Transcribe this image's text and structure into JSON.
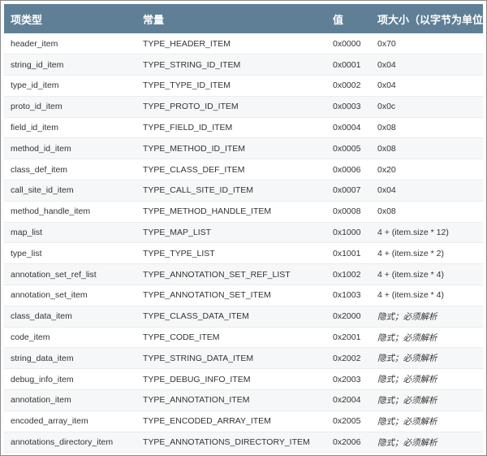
{
  "table": {
    "headers": [
      "项类型",
      "常量",
      "值",
      "项大小（以字节为单位)"
    ],
    "rows": [
      {
        "item": "header_item",
        "constant": "TYPE_HEADER_ITEM",
        "value": "0x0000",
        "size": "0x70"
      },
      {
        "item": "string_id_item",
        "constant": "TYPE_STRING_ID_ITEM",
        "value": "0x0001",
        "size": "0x04"
      },
      {
        "item": "type_id_item",
        "constant": "TYPE_TYPE_ID_ITEM",
        "value": "0x0002",
        "size": "0x04"
      },
      {
        "item": "proto_id_item",
        "constant": "TYPE_PROTO_ID_ITEM",
        "value": "0x0003",
        "size": "0x0c"
      },
      {
        "item": "field_id_item",
        "constant": "TYPE_FIELD_ID_ITEM",
        "value": "0x0004",
        "size": "0x08"
      },
      {
        "item": "method_id_item",
        "constant": "TYPE_METHOD_ID_ITEM",
        "value": "0x0005",
        "size": "0x08"
      },
      {
        "item": "class_def_item",
        "constant": "TYPE_CLASS_DEF_ITEM",
        "value": "0x0006",
        "size": "0x20"
      },
      {
        "item": "call_site_id_item",
        "constant": "TYPE_CALL_SITE_ID_ITEM",
        "value": "0x0007",
        "size": "0x04"
      },
      {
        "item": "method_handle_item",
        "constant": "TYPE_METHOD_HANDLE_ITEM",
        "value": "0x0008",
        "size": "0x08"
      },
      {
        "item": "map_list",
        "constant": "TYPE_MAP_LIST",
        "value": "0x1000",
        "size": "4 + (item.size * 12)"
      },
      {
        "item": "type_list",
        "constant": "TYPE_TYPE_LIST",
        "value": "0x1001",
        "size": "4 + (item.size * 2)"
      },
      {
        "item": "annotation_set_ref_list",
        "constant": "TYPE_ANNOTATION_SET_REF_LIST",
        "value": "0x1002",
        "size": "4 + (item.size * 4)"
      },
      {
        "item": "annotation_set_item",
        "constant": "TYPE_ANNOTATION_SET_ITEM",
        "value": "0x1003",
        "size": "4 + (item.size * 4)"
      },
      {
        "item": "class_data_item",
        "constant": "TYPE_CLASS_DATA_ITEM",
        "value": "0x2000",
        "size": "隐式；必须解析"
      },
      {
        "item": "code_item",
        "constant": "TYPE_CODE_ITEM",
        "value": "0x2001",
        "size": "隐式；必须解析"
      },
      {
        "item": "string_data_item",
        "constant": "TYPE_STRING_DATA_ITEM",
        "value": "0x2002",
        "size": "隐式；必须解析"
      },
      {
        "item": "debug_info_item",
        "constant": "TYPE_DEBUG_INFO_ITEM",
        "value": "0x2003",
        "size": "隐式；必须解析"
      },
      {
        "item": "annotation_item",
        "constant": "TYPE_ANNOTATION_ITEM",
        "value": "0x2004",
        "size": "隐式；必须解析"
      },
      {
        "item": "encoded_array_item",
        "constant": "TYPE_ENCODED_ARRAY_ITEM",
        "value": "0x2005",
        "size": "隐式；必须解析"
      },
      {
        "item": "annotations_directory_item",
        "constant": "TYPE_ANNOTATIONS_DIRECTORY_ITEM",
        "value": "0x2006",
        "size": "隐式；必须解析"
      }
    ]
  }
}
